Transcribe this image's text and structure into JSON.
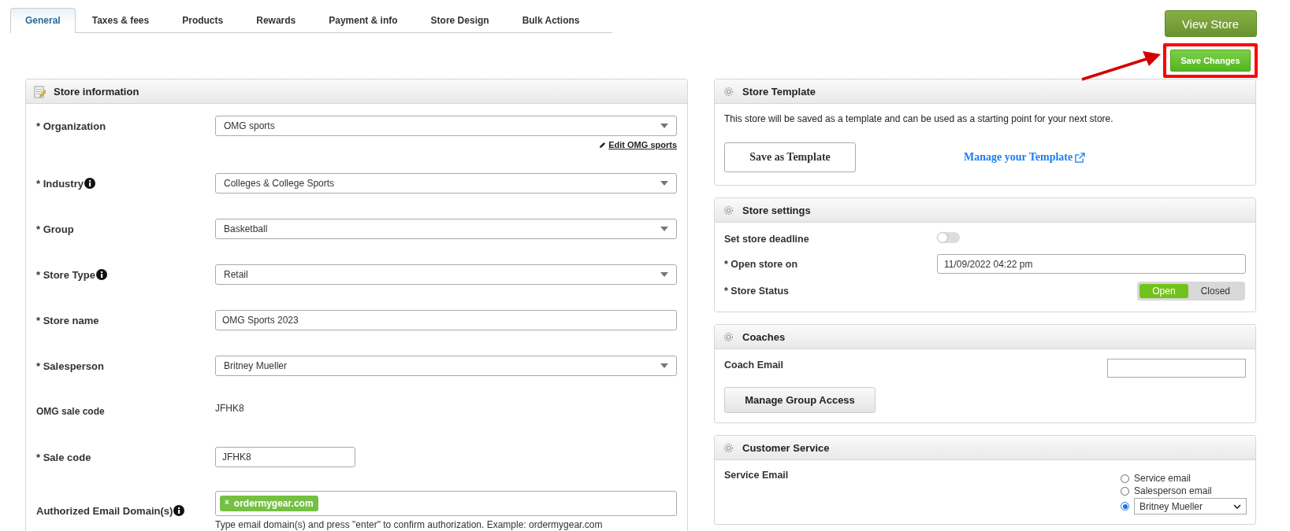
{
  "tabs": [
    {
      "label": "General",
      "selected": true
    },
    {
      "label": "Taxes & fees",
      "selected": false
    },
    {
      "label": "Products",
      "selected": false
    },
    {
      "label": "Rewards",
      "selected": false
    },
    {
      "label": "Payment & info",
      "selected": false
    },
    {
      "label": "Store Design",
      "selected": false
    },
    {
      "label": "Bulk Actions",
      "selected": false
    }
  ],
  "view_store_button": "View Store",
  "save_changes_button": "Save Changes",
  "store_information": {
    "title": "Store information",
    "fields": [
      {
        "kind": "select",
        "label": "* Organization",
        "info": false,
        "value": "OMG sports",
        "link": "Edit OMG sports"
      },
      {
        "kind": "select",
        "label": "* Industry",
        "info": true,
        "value": "Colleges & College Sports"
      },
      {
        "kind": "select",
        "label": "* Group",
        "info": false,
        "value": "Basketball"
      },
      {
        "kind": "select",
        "label": "* Store Type",
        "info": true,
        "value": "Retail"
      },
      {
        "kind": "text",
        "label": "* Store name",
        "info": false,
        "value": "OMG Sports 2023"
      },
      {
        "kind": "select",
        "label": "* Salesperson",
        "info": false,
        "value": "Britney Mueller"
      },
      {
        "kind": "static",
        "label": "OMG sale code",
        "info": false,
        "value": "JFHK8"
      },
      {
        "kind": "short_text",
        "label": "* Sale code",
        "info": false,
        "value": "JFHK8"
      },
      {
        "kind": "tags",
        "label": "Authorized Email Domain(s)",
        "info": true,
        "tags": [
          {
            "remove": "×",
            "label": "ordermygear.com"
          }
        ],
        "hint": "Type email domain(s) and press \"enter\" to confirm authorization. Example: ordermygear.com"
      }
    ]
  },
  "store_template": {
    "title": "Store Template",
    "description": "This store will be saved as a template and can be used as a starting point for your next store.",
    "save_button": "Save as Template",
    "manage_link": "Manage your Template"
  },
  "store_settings": {
    "title": "Store settings",
    "deadline": {
      "label": "Set store deadline",
      "on": false
    },
    "open_on": {
      "label": "* Open store on",
      "value": "11/09/2022 04:22 pm"
    },
    "status": {
      "label": "* Store Status",
      "options": [
        {
          "label": "Open",
          "selected": true
        },
        {
          "label": "Closed",
          "selected": false
        }
      ]
    }
  },
  "coaches": {
    "title": "Coaches",
    "email_label": "Coach Email",
    "manage_button": "Manage Group Access"
  },
  "customer_service": {
    "title": "Customer Service",
    "label": "Service Email",
    "options": [
      {
        "kind": "radio",
        "label": "Service email",
        "selected": false
      },
      {
        "kind": "radio",
        "label": "Salesperson email",
        "selected": false
      },
      {
        "kind": "select",
        "value": "Britney Mueller",
        "selected": true
      }
    ]
  }
}
